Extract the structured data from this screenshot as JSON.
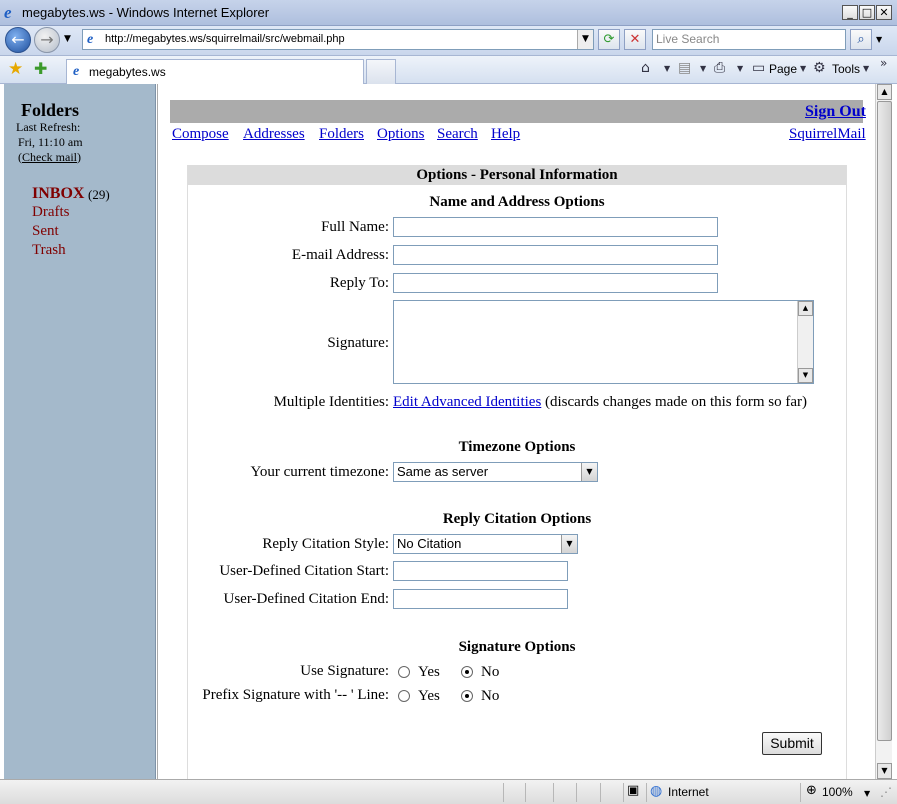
{
  "window": {
    "title": "megabytes.ws - Windows Internet Explorer"
  },
  "addressbar": {
    "url": "http://megabytes.ws/squirrelmail/src/webmail.php",
    "search_placeholder": "Live Search"
  },
  "tab": {
    "title": "megabytes.ws"
  },
  "toolbar": {
    "page_label": "Page",
    "tools_label": "Tools"
  },
  "sidebar": {
    "title": "Folders",
    "last_refresh_label": "Last Refresh:",
    "last_refresh_time": "Fri, 11:10 am",
    "check_mail_open": "(",
    "check_mail_label": "Check mail",
    "check_mail_close": ")",
    "folders": [
      {
        "name": "INBOX",
        "count": "(29)"
      },
      {
        "name": "Drafts"
      },
      {
        "name": "Sent"
      },
      {
        "name": "Trash"
      }
    ]
  },
  "topbar": {
    "sign_out": "Sign Out"
  },
  "nav": {
    "links": [
      "Compose",
      "Addresses",
      "Folders",
      "Options",
      "Search",
      "Help"
    ],
    "brand": "SquirrelMail"
  },
  "options": {
    "header": "Options - Personal Information",
    "name_address": {
      "title": "Name and Address Options",
      "full_name_label": "Full Name:",
      "email_label": "E-mail Address:",
      "reply_to_label": "Reply To:",
      "signature_label": "Signature:",
      "multiple_identities_label": "Multiple Identities:",
      "edit_identities_link": "Edit Advanced Identities",
      "edit_identities_note": "(discards changes made on this form so far)"
    },
    "timezone": {
      "title": "Timezone Options",
      "current_label": "Your current timezone:",
      "current_value": "Same as server"
    },
    "reply_citation": {
      "title": "Reply Citation Options",
      "style_label": "Reply Citation Style:",
      "style_value": "No Citation",
      "start_label": "User-Defined Citation Start:",
      "end_label": "User-Defined Citation End:"
    },
    "signature": {
      "title": "Signature Options",
      "use_label": "Use Signature:",
      "prefix_label": "Prefix Signature with '-- ' Line:",
      "yes": "Yes",
      "no": "No"
    },
    "submit": "Submit"
  },
  "statusbar": {
    "zone": "Internet",
    "zoom": "100%"
  }
}
